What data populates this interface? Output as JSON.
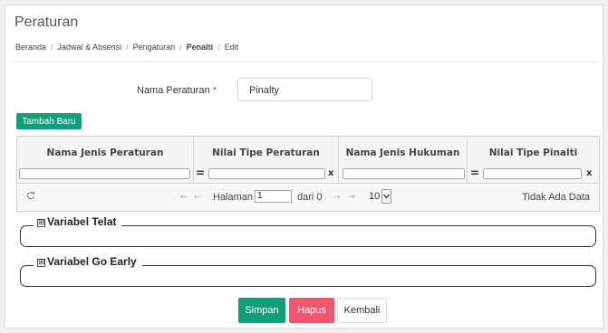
{
  "page": {
    "title": "Peraturan"
  },
  "breadcrumb": {
    "items": [
      "Beranda",
      "Jadwal & Absensi",
      "Pengaturan",
      "Penalti",
      "Edit"
    ],
    "separator": "/"
  },
  "form": {
    "name_label": "Nama Peraturan",
    "required_mark": "*",
    "name_value": "Pinalty"
  },
  "toolbar": {
    "add_label": "Tambah Baru"
  },
  "grid": {
    "columns": [
      "Nama Jenis Peraturan",
      "Nilai Tipe Peraturan",
      "Nama Jenis Hukuman",
      "Nilai Tipe Pinalti"
    ],
    "filter_operator": "=",
    "filter_clear": "x"
  },
  "pager": {
    "refresh_icon": "refresh-icon",
    "first_icon": "⇤",
    "prev_icon": "⇠",
    "next_icon": "⇢",
    "last_icon": "⇥",
    "page_label": "Halaman",
    "page_value": "1",
    "of_label": "dari 0",
    "page_size": "10",
    "no_data": "Tidak Ada Data"
  },
  "sections": {
    "late": {
      "toggle": "⊞",
      "label": "Variabel Telat"
    },
    "early": {
      "toggle": "⊞",
      "label": "Variabel Go Early"
    }
  },
  "actions": {
    "save": "Simpan",
    "delete": "Hapus",
    "back": "Kembali"
  },
  "colors": {
    "accent": "#0fa07a",
    "danger": "#f0566d",
    "required": "#e53935"
  }
}
